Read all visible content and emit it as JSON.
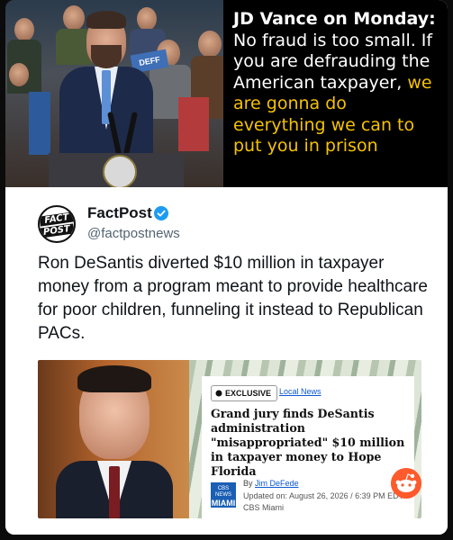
{
  "meme": {
    "lead": "JD Vance on Monday:",
    "line_white": "No fraud is too small. If you are defrauding the American taxpayer,",
    "line_yellow": "we are gonna do everything we can to put you in prison",
    "sign_text": "DEFF",
    "highlight_color": "#f5c200"
  },
  "post": {
    "account_name": "FactPost",
    "handle": "@factpostnews",
    "avatar_text_top": "FACT",
    "avatar_text_bottom": "POST",
    "body": "Ron DeSantis diverted $10 million in taxpayer money from a program meant to provide healthcare for poor children, funneling it instead to Republican PACs."
  },
  "article": {
    "badge": "EXCLUSIVE",
    "section": "Local News",
    "headline": "Grand jury finds DeSantis administration \"misappropriated\" $10 million in taxpayer money to Hope Florida",
    "byline_prefix": "By",
    "author": "Jim DeFede",
    "updated": "Updated on: August 26, 2026 / 6:39 PM EDT",
    "outlet": "CBS Miami",
    "logo_small": "CBS NEWS",
    "logo_big": "MIAMI"
  }
}
